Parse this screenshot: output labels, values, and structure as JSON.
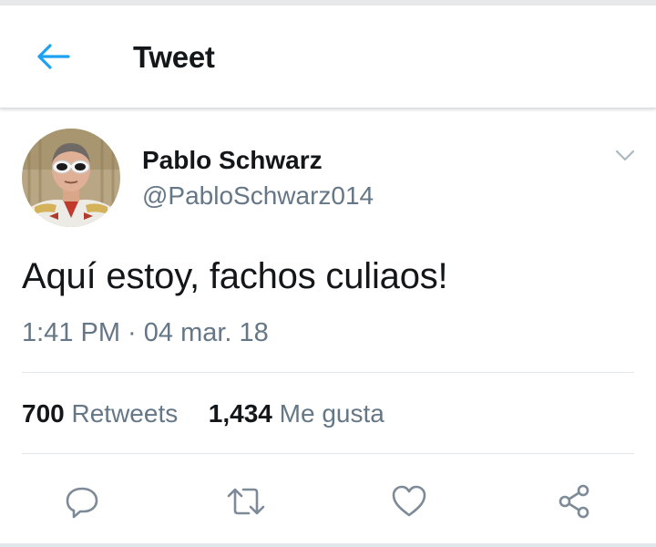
{
  "header": {
    "title": "Tweet",
    "back_icon": "back-arrow-icon",
    "accent_color": "#1da1f2"
  },
  "tweet": {
    "author": {
      "display_name": "Pablo Schwarz",
      "handle": "@PabloSchwarz014"
    },
    "text": "Aquí estoy, fachos culiaos!",
    "timestamp": "1:41 PM · 04 mar. 18",
    "stats": {
      "retweets_count": "700",
      "retweets_label": "Retweets",
      "likes_count": "1,434",
      "likes_label": "Me gusta"
    },
    "actions": [
      "reply-icon",
      "retweet-icon",
      "like-icon",
      "share-icon"
    ]
  },
  "colors": {
    "text_primary": "#14171a",
    "text_secondary": "#657786",
    "icon_gray": "#7d8a97"
  }
}
